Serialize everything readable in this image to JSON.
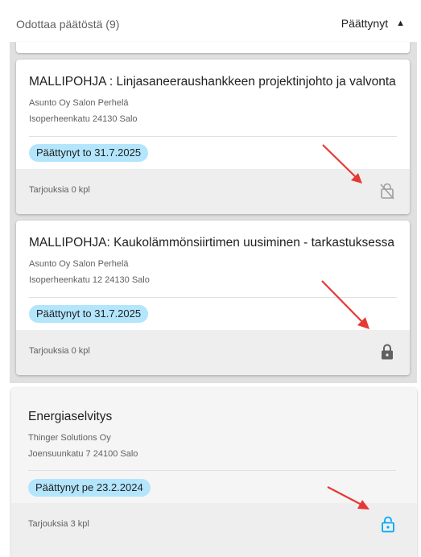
{
  "header": {
    "pending_label": "Odottaa päätöstä (9)",
    "ended_label": "Päättynyt"
  },
  "cards": [
    {
      "title": "MALLIPOHJA : Linjasaneeraushankkeen projektinjohto ja valvonta",
      "org": "Asunto Oy Salon Perhelä",
      "address": "Isoperheenkatu 24130 Salo",
      "status": "Päättynyt to 31.7.2025",
      "offers": "Tarjouksia 0 kpl",
      "lock_icon": "lock-off-icon"
    },
    {
      "title": "MALLIPOHJA: Kaukolämmönsiirtimen uusiminen - tarkastuksessa",
      "org": "Asunto Oy Salon Perhelä",
      "address": "Isoperheenkatu 12 24130 Salo",
      "status": "Päättynyt to 31.7.2025",
      "offers": "Tarjouksia 0 kpl",
      "lock_icon": "lock-icon"
    },
    {
      "title": "Energiaselvitys",
      "org": "Thinger Solutions Oy",
      "address": "Joensuunkatu 7 24100 Salo",
      "status": "Päättynyt pe 23.2.2024",
      "offers": "Tarjouksia 3 kpl",
      "lock_icon": "lock-open-icon"
    }
  ],
  "colors": {
    "chip_bg": "#b3e5fc",
    "lock_grey": "#616161",
    "lock_disabled": "#9e9e9e",
    "lock_open": "#03a9f4",
    "annotation_arrow": "#e53935"
  }
}
